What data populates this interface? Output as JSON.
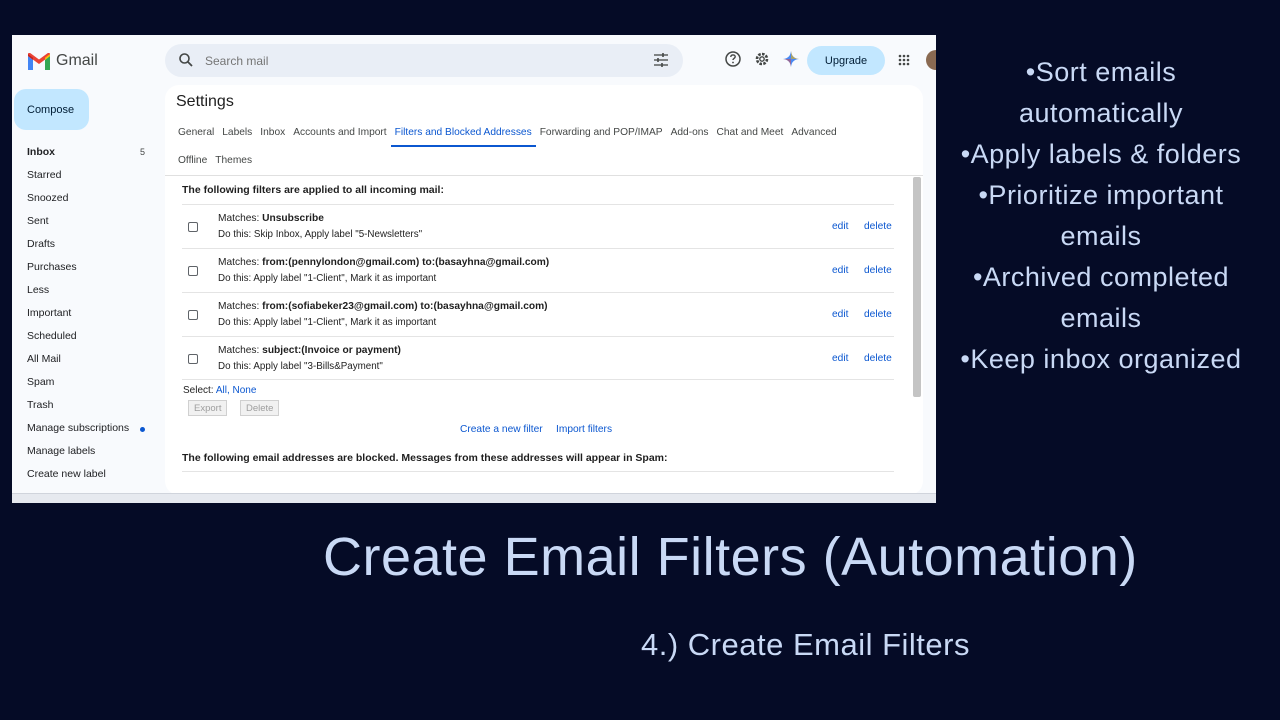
{
  "gmail": {
    "wordmark": "Gmail",
    "search_placeholder": "Search mail",
    "upgrade_label": "Upgrade",
    "compose_label": "Compose",
    "colors": {
      "accent": "#0b57d0",
      "compose_bg": "#c2e7ff",
      "search_bg": "#e9eef6"
    }
  },
  "sidebar": {
    "items": [
      {
        "label": "Inbox",
        "count": "5"
      },
      {
        "label": "Starred"
      },
      {
        "label": "Snoozed"
      },
      {
        "label": "Sent"
      },
      {
        "label": "Drafts"
      },
      {
        "label": "Purchases"
      },
      {
        "label": "Less"
      },
      {
        "label": "Important"
      },
      {
        "label": "Scheduled"
      },
      {
        "label": "All Mail"
      },
      {
        "label": "Spam"
      },
      {
        "label": "Trash"
      },
      {
        "label": "Manage subscriptions"
      },
      {
        "label": "Manage labels"
      },
      {
        "label": "Create new label"
      }
    ]
  },
  "settings": {
    "title": "Settings",
    "tabs_row1": [
      "General",
      "Labels",
      "Inbox",
      "Accounts and Import",
      "Filters and Blocked Addresses",
      "Forwarding and POP/IMAP",
      "Add-ons",
      "Chat and Meet",
      "Advanced"
    ],
    "tabs_row2": [
      "Offline",
      "Themes"
    ],
    "active_tab": "Filters and Blocked Addresses",
    "filters_heading": "The following filters are applied to all incoming mail:",
    "filters": [
      {
        "matches_prefix": "Matches: ",
        "matches": "Unsubscribe",
        "action": "Do this: Skip Inbox, Apply label \"5-Newsletters\""
      },
      {
        "matches_prefix": "Matches: ",
        "matches": "from:(pennylondon@gmail.com) to:(basayhna@gmail.com)",
        "action": "Do this: Apply label \"1-Client\", Mark it as important"
      },
      {
        "matches_prefix": "Matches: ",
        "matches": "from:(sofiabeker23@gmail.com) to:(basayhna@gmail.com)",
        "action": "Do this: Apply label \"1-Client\", Mark it as important"
      },
      {
        "matches_prefix": "Matches: ",
        "matches": "subject:(Invoice or payment)",
        "action": "Do this: Apply label \"3-Bills&Payment\""
      }
    ],
    "edit_label": "edit",
    "delete_label": "delete",
    "select_prefix": "Select: ",
    "select_all": "All",
    "select_sep": ", ",
    "select_none": "None",
    "export_label": "Export",
    "delete_btn_label": "Delete",
    "create_filter": "Create a new filter",
    "import_filters": "Import filters",
    "blocked_heading": "The following email addresses are blocked. Messages from these addresses will appear in Spam:"
  },
  "slide": {
    "bullets": [
      "•Sort emails automatically",
      "•Apply labels & folders",
      "•Prioritize important emails",
      "•Archived completed emails",
      "•Keep inbox organized"
    ],
    "title": "Create Email Filters (Automation)",
    "subtitle": "4.) Create Email Filters",
    "text_color": "#c9d9f5",
    "background": "#050b26"
  }
}
